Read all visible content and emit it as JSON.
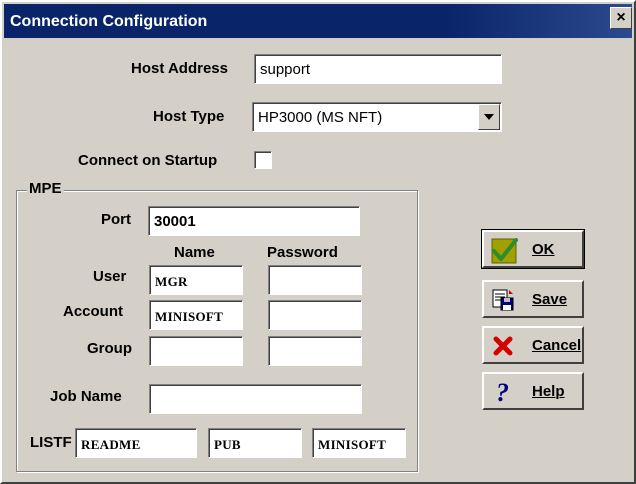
{
  "window": {
    "title": "Connection Configuration",
    "close_label": "×"
  },
  "host": {
    "address_label": "Host Address",
    "address_value": "support",
    "type_label": "Host Type",
    "type_value": "HP3000 (MS NFT)",
    "startup_label": "Connect on Startup",
    "startup_checked": false
  },
  "mpe": {
    "legend": "MPE",
    "port_label": "Port",
    "port_value": "30001",
    "name_header": "Name",
    "password_header": "Password",
    "user_label": "User",
    "user_name": "MGR",
    "user_password": "",
    "account_label": "Account",
    "account_name": "MINISOFT",
    "account_password": "",
    "group_label": "Group",
    "group_name": "",
    "group_password": "",
    "jobname_label": "Job Name",
    "jobname_value": "",
    "listf_label": "LISTF",
    "listf_file": "README",
    "listf_group": "PUB",
    "listf_account": "MINISOFT"
  },
  "buttons": {
    "ok": "OK",
    "save": "Save",
    "cancel": "Cancel",
    "help": "Help"
  },
  "icons": {
    "ok": "checkmark-icon",
    "save": "floppy-disk-icon",
    "cancel": "red-x-icon",
    "help": "question-mark-icon"
  },
  "colors": {
    "titlebar": "#0a246a",
    "face": "#d4d0c8"
  }
}
